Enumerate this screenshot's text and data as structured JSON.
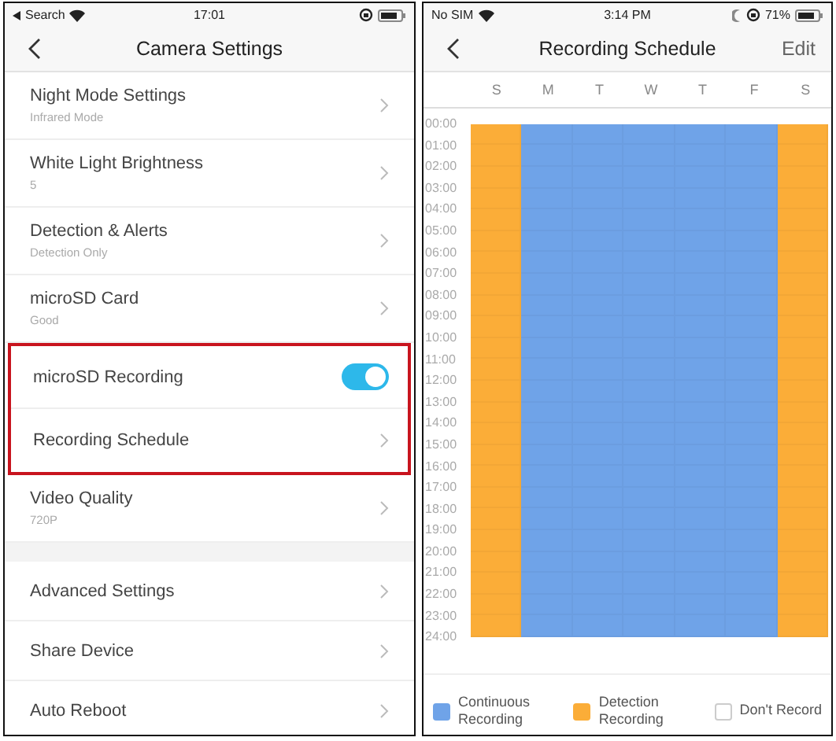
{
  "left": {
    "status_bar": {
      "back_label": "Search",
      "time": "17:01"
    },
    "title": "Camera Settings",
    "sections": [
      {
        "groups": [
          {
            "highlighted": false,
            "items": [
              {
                "kind": "link",
                "label": "Night Mode Settings",
                "subtitle": "Infrared Mode"
              },
              {
                "kind": "link",
                "label": "White Light Brightness",
                "subtitle": "5"
              },
              {
                "kind": "link",
                "label": "Detection & Alerts",
                "subtitle": "Detection Only"
              },
              {
                "kind": "link",
                "label": "microSD Card",
                "subtitle": "Good"
              }
            ]
          },
          {
            "highlighted": true,
            "items": [
              {
                "kind": "toggle",
                "label": "microSD Recording",
                "on": true
              },
              {
                "kind": "link",
                "label": "Recording Schedule"
              }
            ]
          },
          {
            "highlighted": false,
            "items": [
              {
                "kind": "link",
                "label": "Video Quality",
                "subtitle": "720P"
              }
            ]
          }
        ]
      },
      {
        "groups": [
          {
            "highlighted": false,
            "items": [
              {
                "kind": "link",
                "label": "Advanced Settings"
              },
              {
                "kind": "link",
                "label": "Share Device"
              },
              {
                "kind": "link",
                "label": "Auto Reboot"
              }
            ]
          }
        ]
      }
    ]
  },
  "right": {
    "status_bar": {
      "carrier": "No SIM",
      "time": "3:14 PM",
      "battery": "71%"
    },
    "title": "Recording Schedule",
    "edit": "Edit",
    "days": [
      {
        "label": "S",
        "color": "#fbad38"
      },
      {
        "label": "M",
        "color": "#6fa3e8"
      },
      {
        "label": "T",
        "color": "#6fa3e8"
      },
      {
        "label": "W",
        "color": "#6fa3e8"
      },
      {
        "label": "T",
        "color": "#6fa3e8"
      },
      {
        "label": "F",
        "color": "#6fa3e8"
      },
      {
        "label": "S",
        "color": "#fbad38"
      }
    ],
    "hours": [
      "00:00",
      "01:00",
      "02:00",
      "03:00",
      "04:00",
      "05:00",
      "06:00",
      "07:00",
      "08:00",
      "09:00",
      "10:00",
      "11:00",
      "12:00",
      "13:00",
      "14:00",
      "15:00",
      "16:00",
      "17:00",
      "18:00",
      "19:00",
      "20:00",
      "21:00",
      "22:00",
      "23:00",
      "24:00"
    ],
    "legend": [
      {
        "kind": "filled",
        "label": "Continuous Recording",
        "color": "#6fa3e8"
      },
      {
        "kind": "filled",
        "label": "Detection Recording",
        "color": "#fbad38"
      },
      {
        "kind": "outline",
        "label": "Don't Record",
        "color": "#ffffff"
      }
    ]
  }
}
